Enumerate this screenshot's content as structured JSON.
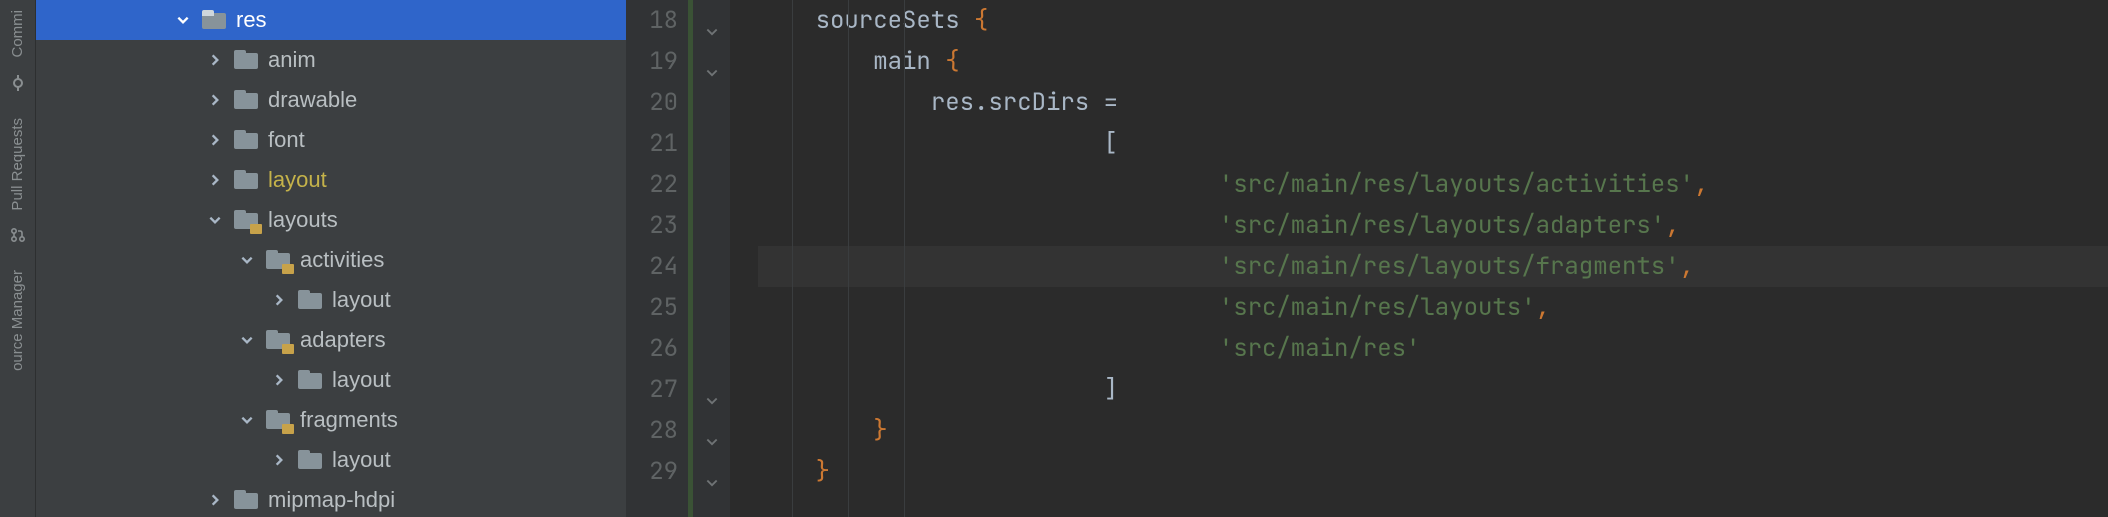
{
  "toolstrip": {
    "tabs": [
      "Commi",
      "Pull Requests",
      "ource Manager"
    ]
  },
  "tree": {
    "rows": [
      {
        "depth": 4,
        "arrow": "down",
        "icon": "res",
        "label": "res",
        "selected": true,
        "highlight": false
      },
      {
        "depth": 5,
        "arrow": "right",
        "icon": "folder",
        "label": "anim",
        "selected": false,
        "highlight": false
      },
      {
        "depth": 5,
        "arrow": "right",
        "icon": "folder",
        "label": "drawable",
        "selected": false,
        "highlight": false
      },
      {
        "depth": 5,
        "arrow": "right",
        "icon": "folder",
        "label": "font",
        "selected": false,
        "highlight": false
      },
      {
        "depth": 5,
        "arrow": "right",
        "icon": "folder",
        "label": "layout",
        "selected": false,
        "highlight": true
      },
      {
        "depth": 5,
        "arrow": "down",
        "icon": "badge",
        "label": "layouts",
        "selected": false,
        "highlight": false
      },
      {
        "depth": 6,
        "arrow": "down",
        "icon": "badge",
        "label": "activities",
        "selected": false,
        "highlight": false
      },
      {
        "depth": 7,
        "arrow": "right",
        "icon": "folder",
        "label": "layout",
        "selected": false,
        "highlight": false
      },
      {
        "depth": 6,
        "arrow": "down",
        "icon": "badge",
        "label": "adapters",
        "selected": false,
        "highlight": false
      },
      {
        "depth": 7,
        "arrow": "right",
        "icon": "folder",
        "label": "layout",
        "selected": false,
        "highlight": false
      },
      {
        "depth": 6,
        "arrow": "down",
        "icon": "badge",
        "label": "fragments",
        "selected": false,
        "highlight": false
      },
      {
        "depth": 7,
        "arrow": "right",
        "icon": "folder",
        "label": "layout",
        "selected": false,
        "highlight": false
      },
      {
        "depth": 5,
        "arrow": "right",
        "icon": "folder",
        "label": "mipmap-hdpi",
        "selected": false,
        "highlight": false
      }
    ]
  },
  "gutter": {
    "start": 18,
    "count": 12,
    "run_at": 18,
    "folds": [
      18,
      19,
      27,
      28,
      29
    ]
  },
  "code": {
    "caret_line": 24,
    "lines": [
      {
        "n": 18,
        "indent": 1,
        "tokens": [
          [
            "kw",
            "sourceSets "
          ],
          [
            "pun",
            "{"
          ]
        ]
      },
      {
        "n": 19,
        "indent": 2,
        "tokens": [
          [
            "kw",
            "main "
          ],
          [
            "pun",
            "{"
          ]
        ]
      },
      {
        "n": 20,
        "indent": 3,
        "tokens": [
          [
            "kw",
            "res.srcDirs "
          ],
          [
            "op",
            "="
          ]
        ]
      },
      {
        "n": 21,
        "indent": 6,
        "tokens": [
          [
            "op",
            "["
          ]
        ]
      },
      {
        "n": 22,
        "indent": 8,
        "tokens": [
          [
            "str",
            "'src/main/res/layouts/activities'"
          ],
          [
            "pun",
            ","
          ]
        ]
      },
      {
        "n": 23,
        "indent": 8,
        "tokens": [
          [
            "str",
            "'src/main/res/layouts/adapters'"
          ],
          [
            "pun",
            ","
          ]
        ]
      },
      {
        "n": 24,
        "indent": 8,
        "tokens": [
          [
            "str",
            "'src/main/res/layouts/fragments'"
          ],
          [
            "pun",
            ","
          ]
        ]
      },
      {
        "n": 25,
        "indent": 8,
        "tokens": [
          [
            "str",
            "'src/main/res/layouts'"
          ],
          [
            "pun",
            ","
          ]
        ]
      },
      {
        "n": 26,
        "indent": 8,
        "tokens": [
          [
            "str",
            "'src/main/res'"
          ]
        ]
      },
      {
        "n": 27,
        "indent": 6,
        "tokens": [
          [
            "op",
            "]"
          ]
        ]
      },
      {
        "n": 28,
        "indent": 2,
        "tokens": [
          [
            "pun",
            "}"
          ]
        ]
      },
      {
        "n": 29,
        "indent": 1,
        "tokens": [
          [
            "pun",
            "}"
          ]
        ]
      }
    ]
  }
}
